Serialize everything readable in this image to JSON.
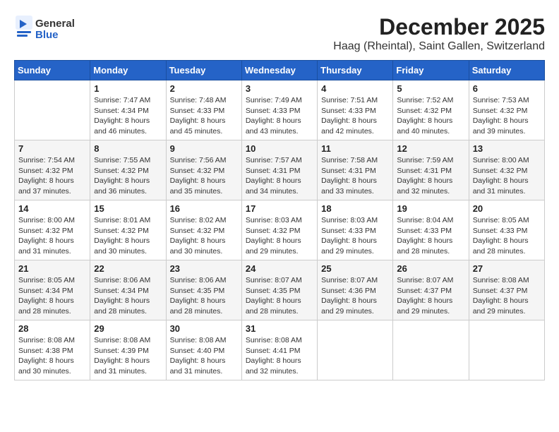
{
  "logo": {
    "general": "General",
    "blue": "Blue"
  },
  "title": {
    "month": "December 2025",
    "location": "Haag (Rheintal), Saint Gallen, Switzerland"
  },
  "weekdays": [
    "Sunday",
    "Monday",
    "Tuesday",
    "Wednesday",
    "Thursday",
    "Friday",
    "Saturday"
  ],
  "weeks": [
    [
      {
        "day": "",
        "info": ""
      },
      {
        "day": "1",
        "info": "Sunrise: 7:47 AM\nSunset: 4:34 PM\nDaylight: 8 hours\nand 46 minutes."
      },
      {
        "day": "2",
        "info": "Sunrise: 7:48 AM\nSunset: 4:33 PM\nDaylight: 8 hours\nand 45 minutes."
      },
      {
        "day": "3",
        "info": "Sunrise: 7:49 AM\nSunset: 4:33 PM\nDaylight: 8 hours\nand 43 minutes."
      },
      {
        "day": "4",
        "info": "Sunrise: 7:51 AM\nSunset: 4:33 PM\nDaylight: 8 hours\nand 42 minutes."
      },
      {
        "day": "5",
        "info": "Sunrise: 7:52 AM\nSunset: 4:32 PM\nDaylight: 8 hours\nand 40 minutes."
      },
      {
        "day": "6",
        "info": "Sunrise: 7:53 AM\nSunset: 4:32 PM\nDaylight: 8 hours\nand 39 minutes."
      }
    ],
    [
      {
        "day": "7",
        "info": "Sunrise: 7:54 AM\nSunset: 4:32 PM\nDaylight: 8 hours\nand 37 minutes."
      },
      {
        "day": "8",
        "info": "Sunrise: 7:55 AM\nSunset: 4:32 PM\nDaylight: 8 hours\nand 36 minutes."
      },
      {
        "day": "9",
        "info": "Sunrise: 7:56 AM\nSunset: 4:32 PM\nDaylight: 8 hours\nand 35 minutes."
      },
      {
        "day": "10",
        "info": "Sunrise: 7:57 AM\nSunset: 4:31 PM\nDaylight: 8 hours\nand 34 minutes."
      },
      {
        "day": "11",
        "info": "Sunrise: 7:58 AM\nSunset: 4:31 PM\nDaylight: 8 hours\nand 33 minutes."
      },
      {
        "day": "12",
        "info": "Sunrise: 7:59 AM\nSunset: 4:31 PM\nDaylight: 8 hours\nand 32 minutes."
      },
      {
        "day": "13",
        "info": "Sunrise: 8:00 AM\nSunset: 4:32 PM\nDaylight: 8 hours\nand 31 minutes."
      }
    ],
    [
      {
        "day": "14",
        "info": "Sunrise: 8:00 AM\nSunset: 4:32 PM\nDaylight: 8 hours\nand 31 minutes."
      },
      {
        "day": "15",
        "info": "Sunrise: 8:01 AM\nSunset: 4:32 PM\nDaylight: 8 hours\nand 30 minutes."
      },
      {
        "day": "16",
        "info": "Sunrise: 8:02 AM\nSunset: 4:32 PM\nDaylight: 8 hours\nand 30 minutes."
      },
      {
        "day": "17",
        "info": "Sunrise: 8:03 AM\nSunset: 4:32 PM\nDaylight: 8 hours\nand 29 minutes."
      },
      {
        "day": "18",
        "info": "Sunrise: 8:03 AM\nSunset: 4:33 PM\nDaylight: 8 hours\nand 29 minutes."
      },
      {
        "day": "19",
        "info": "Sunrise: 8:04 AM\nSunset: 4:33 PM\nDaylight: 8 hours\nand 28 minutes."
      },
      {
        "day": "20",
        "info": "Sunrise: 8:05 AM\nSunset: 4:33 PM\nDaylight: 8 hours\nand 28 minutes."
      }
    ],
    [
      {
        "day": "21",
        "info": "Sunrise: 8:05 AM\nSunset: 4:34 PM\nDaylight: 8 hours\nand 28 minutes."
      },
      {
        "day": "22",
        "info": "Sunrise: 8:06 AM\nSunset: 4:34 PM\nDaylight: 8 hours\nand 28 minutes."
      },
      {
        "day": "23",
        "info": "Sunrise: 8:06 AM\nSunset: 4:35 PM\nDaylight: 8 hours\nand 28 minutes."
      },
      {
        "day": "24",
        "info": "Sunrise: 8:07 AM\nSunset: 4:35 PM\nDaylight: 8 hours\nand 28 minutes."
      },
      {
        "day": "25",
        "info": "Sunrise: 8:07 AM\nSunset: 4:36 PM\nDaylight: 8 hours\nand 29 minutes."
      },
      {
        "day": "26",
        "info": "Sunrise: 8:07 AM\nSunset: 4:37 PM\nDaylight: 8 hours\nand 29 minutes."
      },
      {
        "day": "27",
        "info": "Sunrise: 8:08 AM\nSunset: 4:37 PM\nDaylight: 8 hours\nand 29 minutes."
      }
    ],
    [
      {
        "day": "28",
        "info": "Sunrise: 8:08 AM\nSunset: 4:38 PM\nDaylight: 8 hours\nand 30 minutes."
      },
      {
        "day": "29",
        "info": "Sunrise: 8:08 AM\nSunset: 4:39 PM\nDaylight: 8 hours\nand 31 minutes."
      },
      {
        "day": "30",
        "info": "Sunrise: 8:08 AM\nSunset: 4:40 PM\nDaylight: 8 hours\nand 31 minutes."
      },
      {
        "day": "31",
        "info": "Sunrise: 8:08 AM\nSunset: 4:41 PM\nDaylight: 8 hours\nand 32 minutes."
      },
      {
        "day": "",
        "info": ""
      },
      {
        "day": "",
        "info": ""
      },
      {
        "day": "",
        "info": ""
      }
    ]
  ]
}
